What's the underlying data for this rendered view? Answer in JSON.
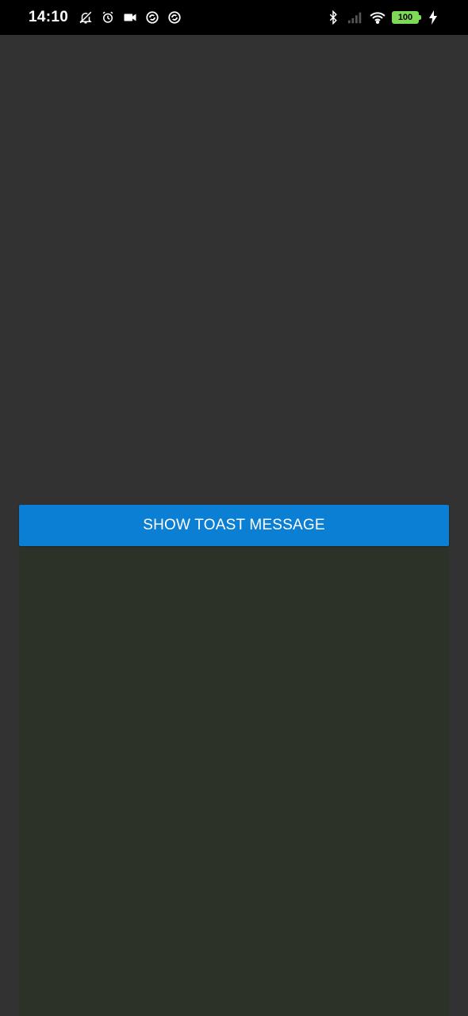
{
  "status_bar": {
    "time": "14:10",
    "battery_level": "100",
    "icons_left": [
      "bell-off-icon",
      "alarm-icon",
      "video-camera-icon",
      "sync-icon",
      "sync-icon"
    ],
    "icons_right": [
      "bluetooth-icon",
      "cellular-signal-icon",
      "wifi-icon",
      "battery-icon",
      "charging-icon"
    ],
    "battery_color": "#7ed957"
  },
  "main": {
    "show_toast_button_label": "SHOW TOAST MESSAGE",
    "button_color": "#0a7fd3",
    "background_color": "#323232"
  }
}
